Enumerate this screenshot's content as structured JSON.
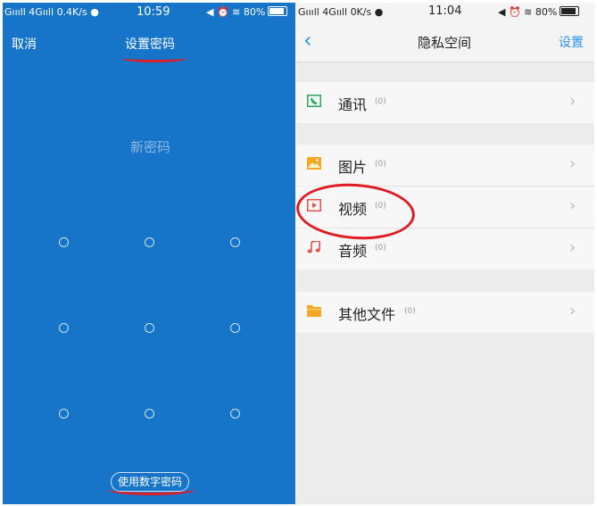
{
  "left": {
    "status": {
      "signal": "Gıııll 4Gııll",
      "speed": "0.4K/s",
      "time": "10:59",
      "battery": "80%"
    },
    "header": {
      "cancel_label": "取消",
      "title": "设置密码"
    },
    "prompt": "新密码",
    "numeric_pw_label": "使用数字密码",
    "colors": {
      "background": "#1775c9",
      "annotation": "#e01d24"
    }
  },
  "right": {
    "status": {
      "signal": "Gıııll 4Gııll",
      "speed": "0K/s",
      "time": "11:04",
      "battery": "80%"
    },
    "nav": {
      "back_icon": "chevron-left-icon",
      "title": "隐私空间",
      "settings_label": "设置"
    },
    "sections": [
      {
        "items": [
          {
            "label": "通讯",
            "count": "(0)",
            "icon": "contacts-icon",
            "color": "#2aa55c"
          }
        ]
      },
      {
        "items": [
          {
            "label": "图片",
            "count": "(0)",
            "icon": "image-icon",
            "color": "#f5a623"
          },
          {
            "label": "视频",
            "count": "(0)",
            "icon": "video-icon",
            "color": "#e5534b"
          },
          {
            "label": "音频",
            "count": "(0)",
            "icon": "audio-icon",
            "color": "#e5534b"
          }
        ]
      },
      {
        "items": [
          {
            "label": "其他文件",
            "count": "(0)",
            "icon": "folder-icon",
            "color": "#f5a623"
          }
        ]
      }
    ],
    "chevron": "›"
  }
}
